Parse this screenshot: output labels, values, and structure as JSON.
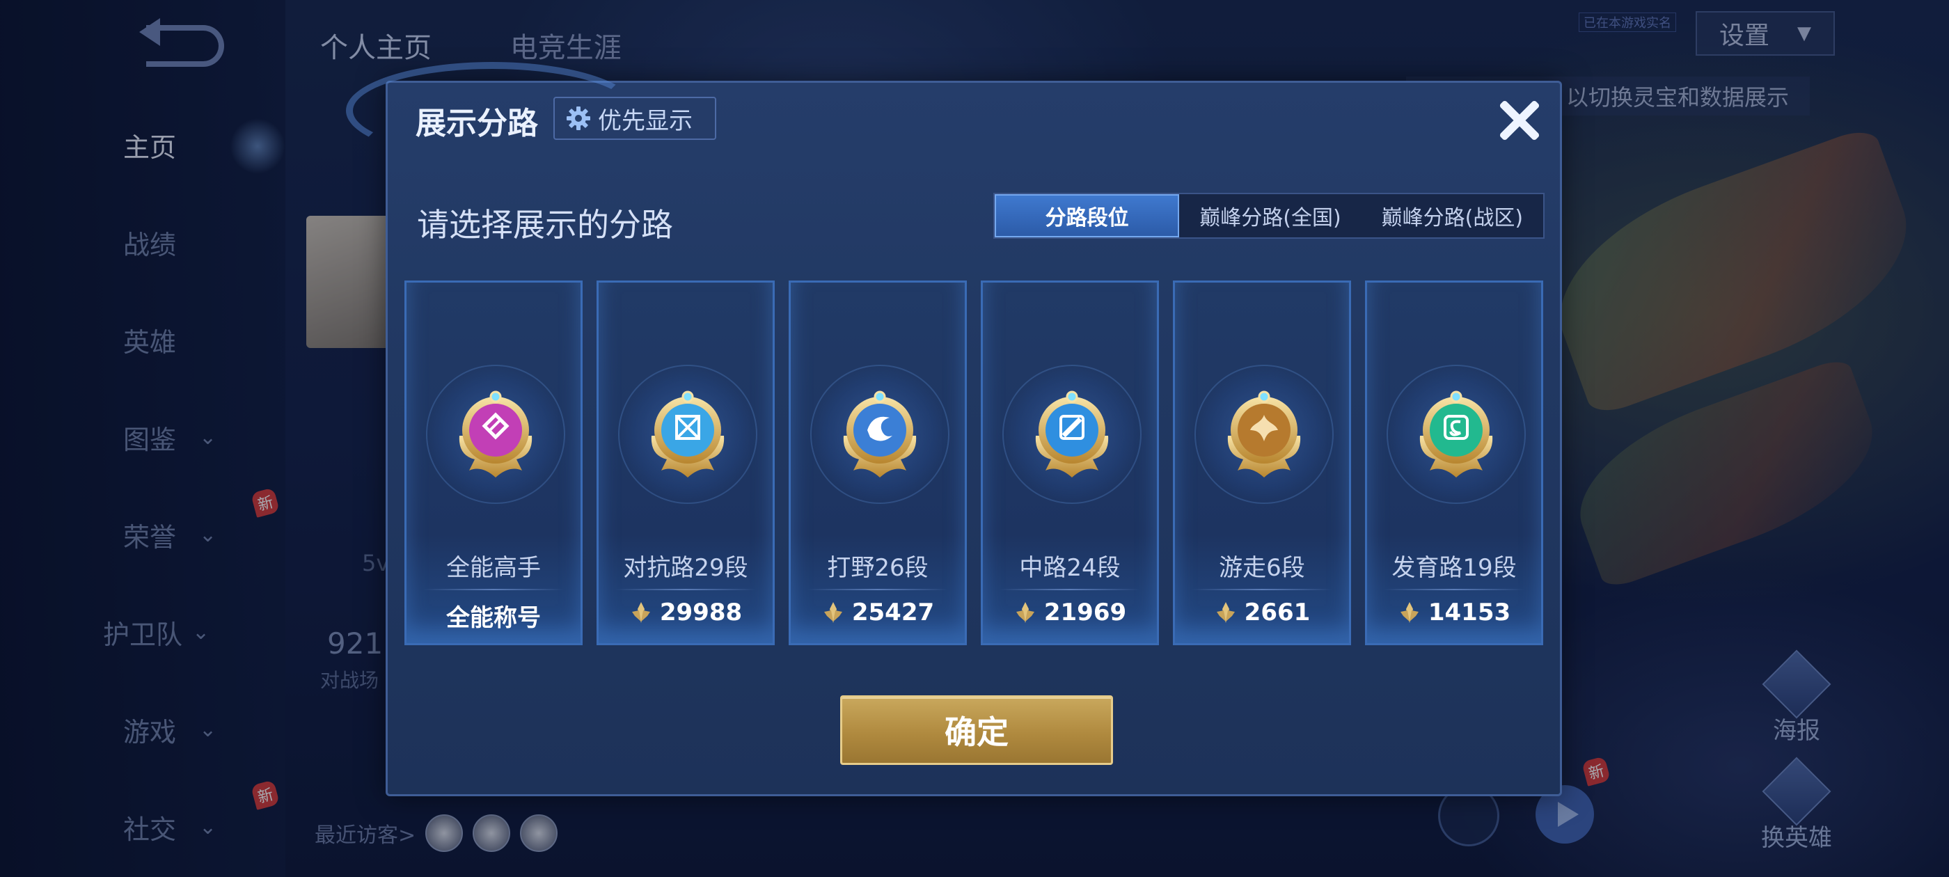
{
  "nav": {
    "items": [
      {
        "label": "主页",
        "active": true,
        "chevron": false,
        "new": false
      },
      {
        "label": "战绩",
        "active": false,
        "chevron": false,
        "new": false
      },
      {
        "label": "英雄",
        "active": false,
        "chevron": false,
        "new": false
      },
      {
        "label": "图鉴",
        "active": false,
        "chevron": true,
        "new": false
      },
      {
        "label": "荣誉",
        "active": false,
        "chevron": true,
        "new": true
      },
      {
        "label": "护卫队",
        "active": false,
        "chevron": true,
        "new": false
      },
      {
        "label": "游戏",
        "active": false,
        "chevron": true,
        "new": false
      },
      {
        "label": "社交",
        "active": false,
        "chevron": true,
        "new": true
      }
    ],
    "new_tag": "新"
  },
  "profile": {
    "tabs": [
      "个人主页",
      "电竞生涯"
    ],
    "stat_5v": "5v",
    "stat_big": "921",
    "stat_small": "对战场",
    "visitors_label": "最近访客>"
  },
  "top_right": {
    "anti_addiction": "已在本游戏实名",
    "settings_label": "设置",
    "hint": "以切换灵宝和数据展示"
  },
  "side_buttons": {
    "poster": "海报",
    "change_hero": "换英雄"
  },
  "modal": {
    "title": "展示分路",
    "priority_label": "优先显示",
    "section_title": "请选择展示的分路",
    "tabs": [
      {
        "label": "分路段位",
        "active": true
      },
      {
        "label": "巅峰分路(全国)",
        "active": false
      },
      {
        "label": "巅峰分路(战区)",
        "active": false
      }
    ],
    "cards": [
      {
        "name": "全能高手",
        "value": "全能称号",
        "has_points": false,
        "emblem_color": "#c23fb6",
        "emblem": "all-round-emblem-icon"
      },
      {
        "name": "对抗路29段",
        "value": "29988",
        "has_points": true,
        "emblem_color": "#3aa6e6",
        "emblem": "clash-lane-emblem-icon"
      },
      {
        "name": "打野26段",
        "value": "25427",
        "has_points": true,
        "emblem_color": "#3b7fd6",
        "emblem": "jungle-emblem-icon"
      },
      {
        "name": "中路24段",
        "value": "21969",
        "has_points": true,
        "emblem_color": "#2f8fe0",
        "emblem": "mid-lane-emblem-icon"
      },
      {
        "name": "游走6段",
        "value": "2661",
        "has_points": true,
        "emblem_color": "#b67a2e",
        "emblem": "roam-emblem-icon"
      },
      {
        "name": "发育路19段",
        "value": "14153",
        "has_points": true,
        "emblem_color": "#22b98f",
        "emblem": "farm-lane-emblem-icon"
      }
    ],
    "confirm_label": "确定"
  }
}
